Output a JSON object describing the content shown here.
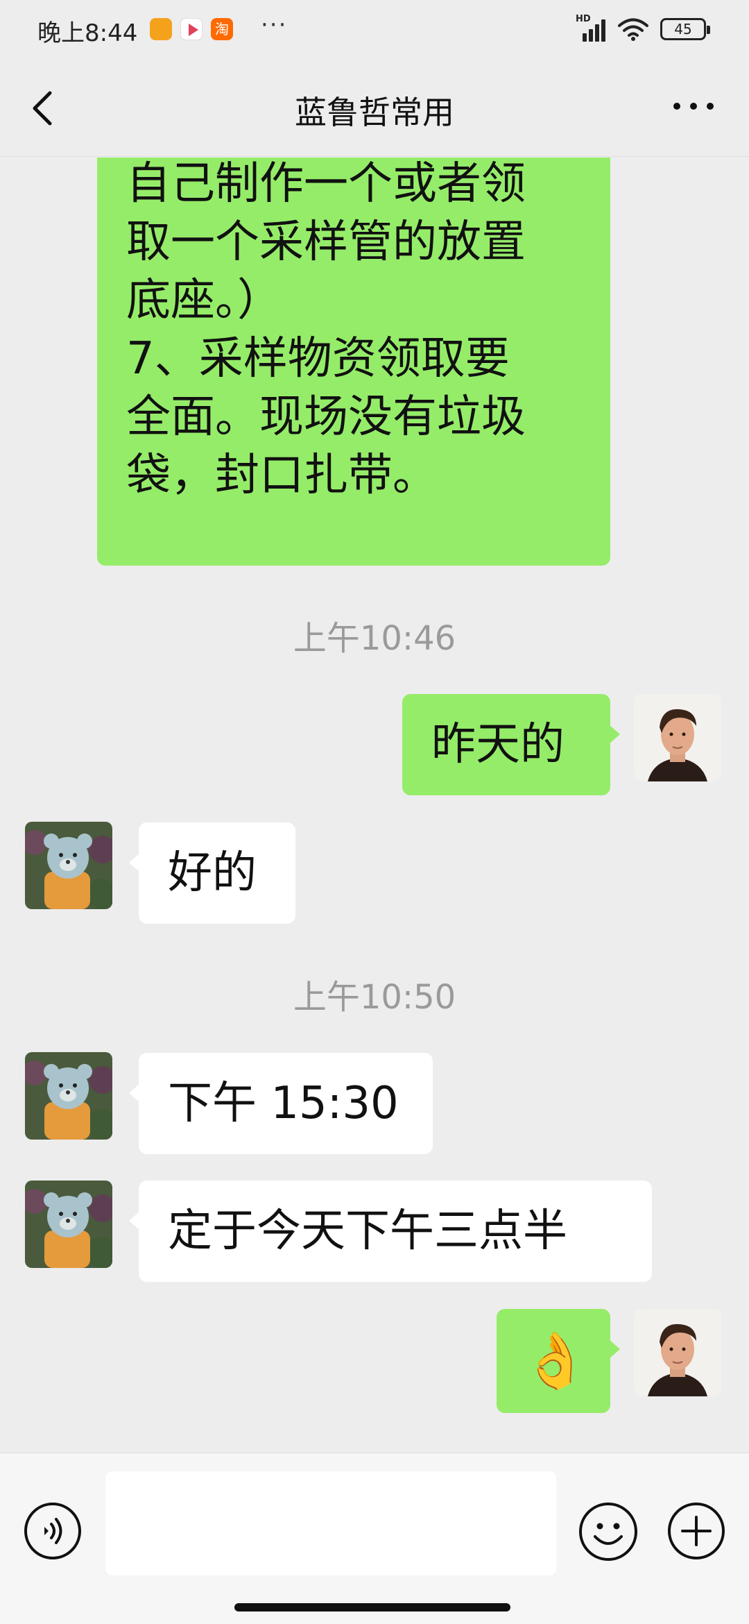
{
  "status_bar": {
    "time": "晚上8:44",
    "more": "···",
    "network": "HD",
    "battery": "45",
    "app_icons": [
      "message-app-icon",
      "video-app-icon",
      "taobao-app-icon"
    ],
    "taobao_glyph": "淘"
  },
  "header": {
    "title": "蓝鲁哲常用",
    "back_icon": "chevron-left-icon",
    "more_icon": "more-dots-icon"
  },
  "messages": [
    {
      "type": "outgoing",
      "text": "自己制作一个或者领\n取一个采样管的放置\n底座。）\n7、采样物资领取要\n全面。现场没有垃圾\n袋，封口扎带。"
    },
    {
      "type": "timestamp",
      "text": "上午10:46"
    },
    {
      "type": "outgoing",
      "text": "昨天的"
    },
    {
      "type": "incoming",
      "text": "好的"
    },
    {
      "type": "timestamp",
      "text": "上午10:50"
    },
    {
      "type": "incoming",
      "text": "下午 15:30"
    },
    {
      "type": "incoming",
      "text": "定于今天下午三点半"
    },
    {
      "type": "outgoing",
      "text": "👌"
    }
  ],
  "input_bar": {
    "voice_icon": "voice-icon",
    "emoji_icon": "emoji-icon",
    "plus_icon": "plus-icon",
    "text_value": ""
  },
  "colors": {
    "background": "#ededed",
    "outgoing_bubble": "#95ec69",
    "incoming_bubble": "#ffffff",
    "timestamp": "#9a9a9a"
  }
}
